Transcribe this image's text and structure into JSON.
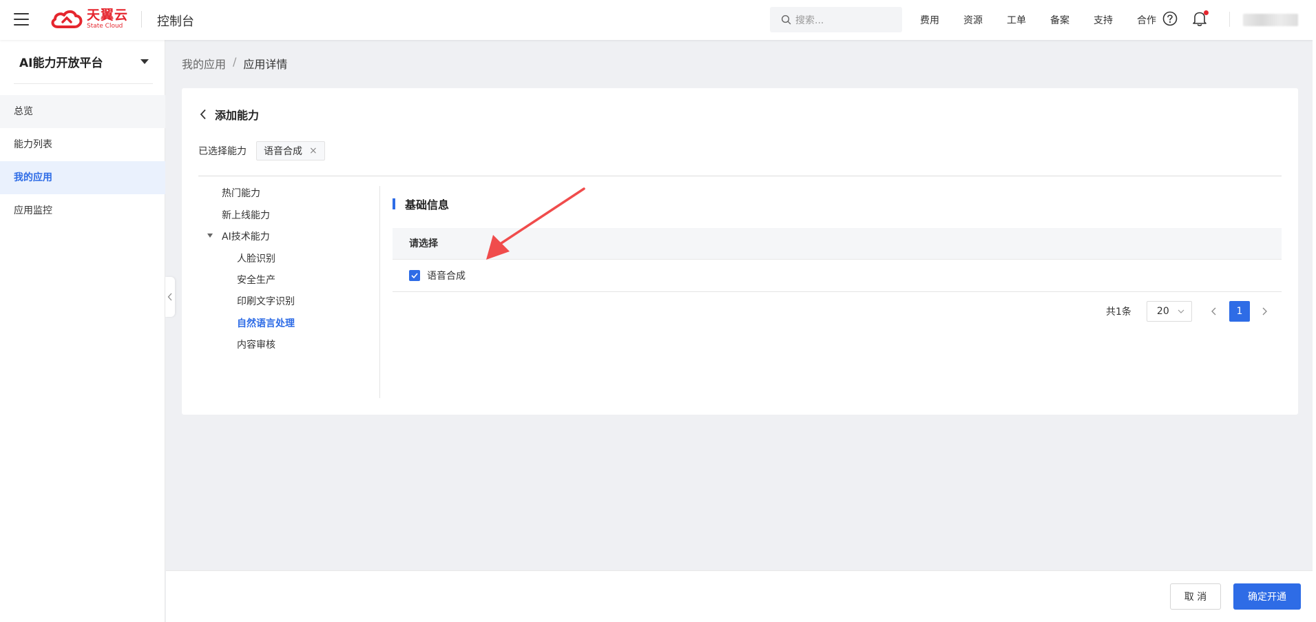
{
  "header": {
    "brand_cn": "天翼云",
    "brand_en": "State Cloud",
    "console_title": "控制台",
    "search_placeholder": "搜索...",
    "nav": [
      "费用",
      "资源",
      "工单",
      "备案",
      "支持",
      "合作"
    ],
    "icons": [
      "menu-icon",
      "search-icon",
      "help-icon",
      "bell-icon"
    ],
    "brand_color": "#e5262e"
  },
  "sidebar": {
    "title": "AI能力开放平台",
    "items": [
      {
        "label": "总览",
        "state": "hover"
      },
      {
        "label": "能力列表",
        "state": ""
      },
      {
        "label": "我的应用",
        "state": "active"
      },
      {
        "label": "应用监控",
        "state": ""
      }
    ]
  },
  "breadcrumb": {
    "root": "我的应用",
    "separator": "/",
    "current": "应用详情"
  },
  "card": {
    "title": "添加能力",
    "selected_label": "已选择能力",
    "selected_tags": [
      "语音合成"
    ],
    "tag_close": "×"
  },
  "tree": {
    "items": [
      {
        "label": "热门能力",
        "level": 1
      },
      {
        "label": "新上线能力",
        "level": 1
      },
      {
        "label": "AI技术能力",
        "level": 1,
        "expanded": true
      },
      {
        "label": "人脸识别",
        "level": 2
      },
      {
        "label": "安全生产",
        "level": 2
      },
      {
        "label": "印刷文字识别",
        "level": 2
      },
      {
        "label": "自然语言处理",
        "level": 2,
        "active": true
      },
      {
        "label": "内容审核",
        "level": 2
      }
    ]
  },
  "section": {
    "title": "基础信息",
    "table_header": "请选择",
    "rows": [
      {
        "label": "语音合成",
        "checked": true
      }
    ]
  },
  "pagination": {
    "total": "共1条",
    "page_size": "20",
    "current_page": "1"
  },
  "footer": {
    "cancel": "取 消",
    "confirm": "确定开通"
  },
  "accent_color": "#2e6ce6",
  "annotation_arrow_color": "#f04c4c"
}
